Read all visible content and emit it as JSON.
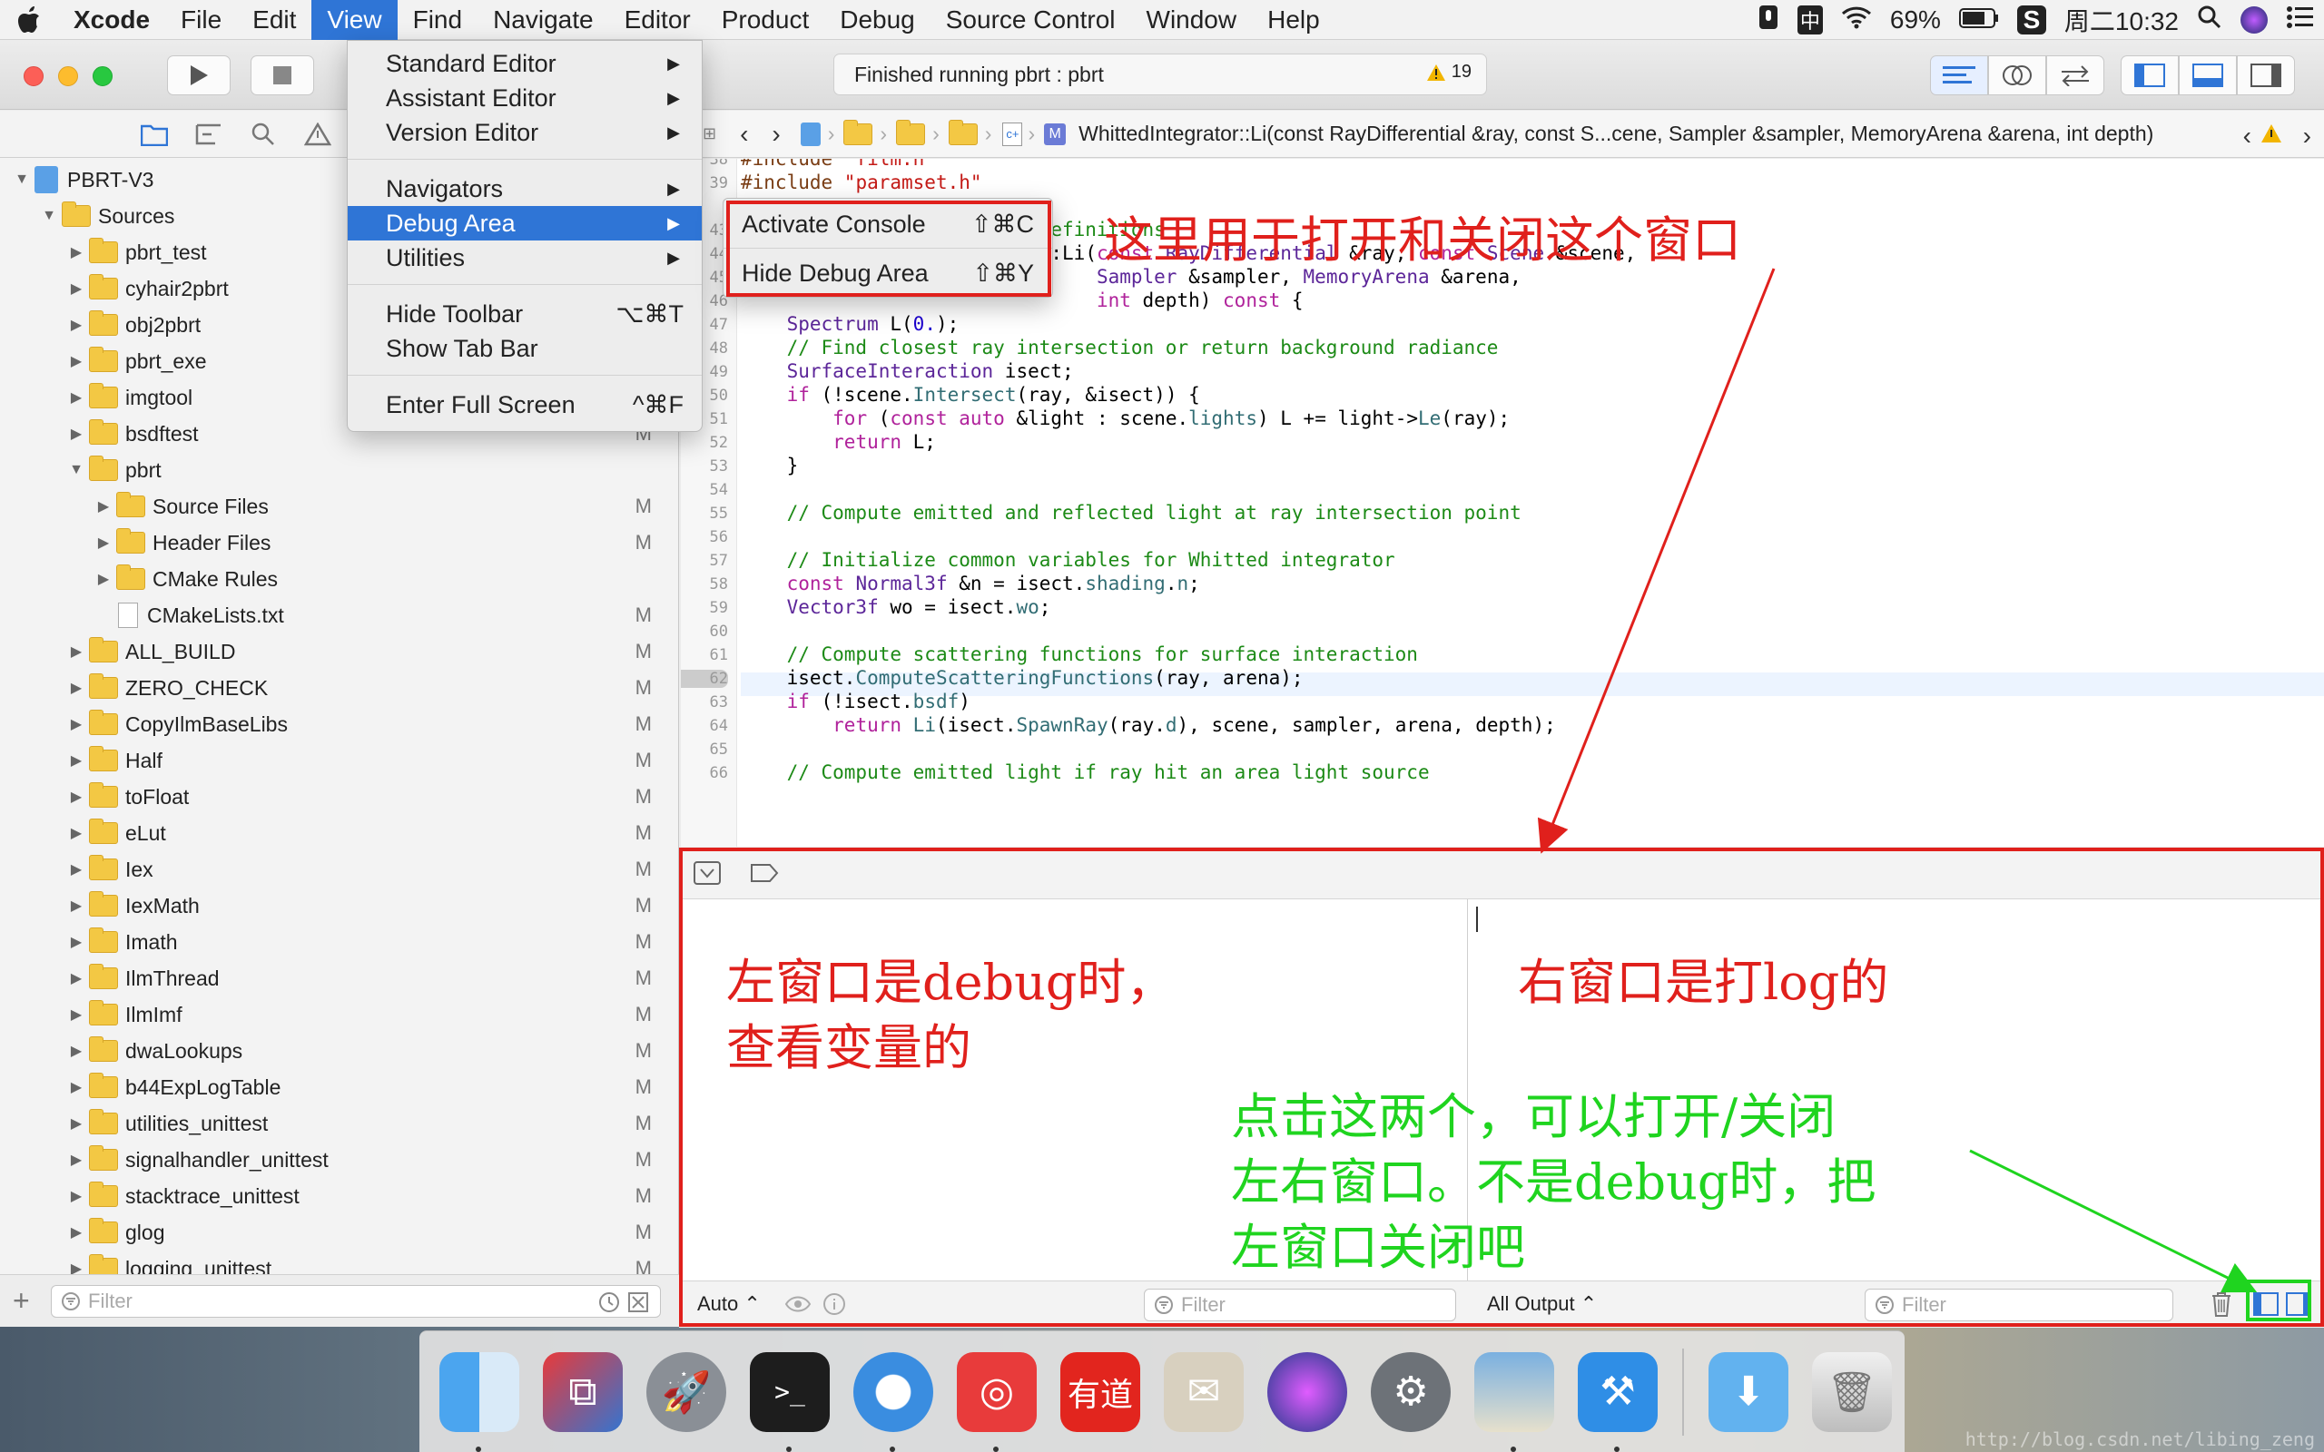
{
  "menubar": {
    "app": "Xcode",
    "items": [
      "File",
      "Edit",
      "View",
      "Find",
      "Navigate",
      "Editor",
      "Product",
      "Debug",
      "Source Control",
      "Window",
      "Help"
    ],
    "active": "View",
    "status": {
      "battery": "69%",
      "time": "周二10:32",
      "input1": "中"
    }
  },
  "toolbar": {
    "activity": "Finished running pbrt : pbrt",
    "warnings": "19"
  },
  "view_menu": {
    "items": [
      {
        "label": "Standard Editor",
        "submenu": true
      },
      {
        "label": "Assistant Editor",
        "submenu": true
      },
      {
        "label": "Version Editor",
        "submenu": true
      },
      {
        "label": "Navigators",
        "submenu": true
      },
      {
        "label": "Debug Area",
        "submenu": true
      },
      {
        "label": "Utilities",
        "submenu": true
      },
      {
        "label": "Hide Toolbar",
        "shortcut": "⌥⌘T"
      },
      {
        "label": "Show Tab Bar"
      },
      {
        "label": "Enter Full Screen",
        "shortcut": "^⌘F"
      }
    ],
    "submenu": [
      {
        "label": "Activate Console",
        "shortcut": "⇧⌘C"
      },
      {
        "label": "Hide Debug Area",
        "shortcut": "⇧⌘Y"
      }
    ]
  },
  "navigator": {
    "rows": [
      {
        "label": "PBRT-V3",
        "kind": "project",
        "level": 0,
        "open": true,
        "mark": ""
      },
      {
        "label": "Sources",
        "kind": "folder",
        "level": 1,
        "open": true,
        "mark": ""
      },
      {
        "label": "pbrt_test",
        "kind": "folder",
        "level": 2,
        "mark": "M"
      },
      {
        "label": "cyhair2pbrt",
        "kind": "folder",
        "level": 2,
        "mark": "M"
      },
      {
        "label": "obj2pbrt",
        "kind": "folder",
        "level": 2,
        "mark": "M"
      },
      {
        "label": "pbrt_exe",
        "kind": "folder",
        "level": 2,
        "mark": "M"
      },
      {
        "label": "imgtool",
        "kind": "folder",
        "level": 2,
        "mark": "M"
      },
      {
        "label": "bsdftest",
        "kind": "folder",
        "level": 2,
        "mark": "M"
      },
      {
        "label": "pbrt",
        "kind": "folder",
        "level": 2,
        "open": true,
        "mark": ""
      },
      {
        "label": "Source Files",
        "kind": "folder",
        "level": 3,
        "mark": "M"
      },
      {
        "label": "Header Files",
        "kind": "folder",
        "level": 3,
        "mark": "M"
      },
      {
        "label": "CMake Rules",
        "kind": "folder",
        "level": 3,
        "mark": ""
      },
      {
        "label": "CMakeLists.txt",
        "kind": "file",
        "level": 3,
        "mark": "M"
      },
      {
        "label": "ALL_BUILD",
        "kind": "folder",
        "level": 2,
        "mark": "M"
      },
      {
        "label": "ZERO_CHECK",
        "kind": "folder",
        "level": 2,
        "mark": "M"
      },
      {
        "label": "CopyIlmBaseLibs",
        "kind": "folder",
        "level": 2,
        "mark": "M"
      },
      {
        "label": "Half",
        "kind": "folder",
        "level": 2,
        "mark": "M"
      },
      {
        "label": "toFloat",
        "kind": "folder",
        "level": 2,
        "mark": "M"
      },
      {
        "label": "eLut",
        "kind": "folder",
        "level": 2,
        "mark": "M"
      },
      {
        "label": "Iex",
        "kind": "folder",
        "level": 2,
        "mark": "M"
      },
      {
        "label": "IexMath",
        "kind": "folder",
        "level": 2,
        "mark": "M"
      },
      {
        "label": "Imath",
        "kind": "folder",
        "level": 2,
        "mark": "M"
      },
      {
        "label": "IlmThread",
        "kind": "folder",
        "level": 2,
        "mark": "M"
      },
      {
        "label": "IlmImf",
        "kind": "folder",
        "level": 2,
        "mark": "M"
      },
      {
        "label": "dwaLookups",
        "kind": "folder",
        "level": 2,
        "mark": "M"
      },
      {
        "label": "b44ExpLogTable",
        "kind": "folder",
        "level": 2,
        "mark": "M"
      },
      {
        "label": "utilities_unittest",
        "kind": "folder",
        "level": 2,
        "mark": "M"
      },
      {
        "label": "signalhandler_unittest",
        "kind": "folder",
        "level": 2,
        "mark": "M"
      },
      {
        "label": "stacktrace_unittest",
        "kind": "folder",
        "level": 2,
        "mark": "M"
      },
      {
        "label": "glog",
        "kind": "folder",
        "level": 2,
        "mark": "M"
      },
      {
        "label": "logging_unittest",
        "kind": "folder",
        "level": 2,
        "mark": "M"
      }
    ],
    "filter_placeholder": "Filter"
  },
  "jumpbar": {
    "symbol": "WhittedIntegrator::Li(const RayDifferential &ray, const S...cene, Sampler &sampler, MemoryArena &arena, int depth)"
  },
  "code": {
    "lines": [
      {
        "n": "38",
        "html": "<span class='pp'>#include </span><span class='st'>\"film.h\"</span>"
      },
      {
        "n": "39",
        "html": "<span class='pp'>#include </span><span class='st'>\"paramset.h\"</span>"
      },
      {
        "n": "43",
        "html": "<span class='cm'>                        d Definitions</span>"
      },
      {
        "n": "44",
        "html": "<span class='ty'>Spectrum</span> <span class='ty'>WhittedIntegrator</span>::Li(<span class='kw'>const</span> <span class='ty'>RayDifferential</span> &amp;ray, <span class='kw'>const</span> <span class='ty'>Scene</span> &amp;scene,"
      },
      {
        "n": "45",
        "html": "                               <span class='ty'>Sampler</span> &amp;sampler, <span class='ty'>MemoryArena</span> &amp;arena,"
      },
      {
        "n": "46",
        "html": "                               <span class='kw'>int</span> depth) <span class='kw'>const</span> {"
      },
      {
        "n": "47",
        "html": "    <span class='ty'>Spectrum</span> L(<span class='nm'>0.</span>);"
      },
      {
        "n": "48",
        "html": "    <span class='cm'>// Find closest ray intersection or return background radiance</span>"
      },
      {
        "n": "49",
        "html": "    <span class='ty'>SurfaceInteraction</span> isect;"
      },
      {
        "n": "50",
        "html": "    <span class='kw'>if</span> (!scene.<span class='fn'>Intersect</span>(ray, &amp;isect)) {"
      },
      {
        "n": "51",
        "html": "        <span class='kw'>for</span> (<span class='kw'>const auto</span> &amp;light : scene.<span class='fn'>lights</span>) L += light-&gt;<span class='fn'>Le</span>(ray);"
      },
      {
        "n": "52",
        "html": "        <span class='kw'>return</span> L;"
      },
      {
        "n": "53",
        "html": "    }"
      },
      {
        "n": "54",
        "html": ""
      },
      {
        "n": "55",
        "html": "    <span class='cm'>// Compute emitted and reflected light at ray intersection point</span>"
      },
      {
        "n": "56",
        "html": ""
      },
      {
        "n": "57",
        "html": "    <span class='cm'>// Initialize common variables for Whitted integrator</span>"
      },
      {
        "n": "58",
        "html": "    <span class='kw'>const</span> <span class='ty'>Normal3f</span> &amp;n = isect.<span class='fn'>shading</span>.<span class='fn'>n</span>;"
      },
      {
        "n": "59",
        "html": "    <span class='ty'>Vector3f</span> wo = isect.<span class='fn'>wo</span>;"
      },
      {
        "n": "60",
        "html": ""
      },
      {
        "n": "61",
        "html": "    <span class='cm'>// Compute scattering functions for surface interaction</span>"
      },
      {
        "n": "62",
        "html": "    isect.<span class='fn'>ComputeScatteringFunctions</span>(ray, arena);"
      },
      {
        "n": "63",
        "html": "    <span class='kw'>if</span> (!isect.<span class='fn'>bsdf</span>)"
      },
      {
        "n": "64",
        "html": "        <span class='kw'>return</span> <span class='fn'>Li</span>(isect.<span class='fn'>SpawnRay</span>(ray.<span class='fn'>d</span>), scene, sampler, arena, depth);"
      },
      {
        "n": "65",
        "html": ""
      },
      {
        "n": "66",
        "html": "    <span class='cm'>// Compute emitted light if ray hit an area light source</span>"
      }
    ]
  },
  "debug": {
    "left_scope": "Auto ⌃",
    "right_scope": "All Output ⌃",
    "filter_placeholder": "Filter"
  },
  "annotations": {
    "top": "这里用于打开和关闭这个窗口",
    "left1": "左窗口是debug时，",
    "left2": "查看变量的",
    "right": "右窗口是打log的",
    "green1": "点击这两个，可以打开/关闭",
    "green2": "左右窗口。不是debug时，把",
    "green3": "左窗口关闭吧"
  },
  "watermark": "http://blog.csdn.net/libing_zeng",
  "colors": {
    "accent": "#2f75d6",
    "annotation_red": "#e0201c",
    "annotation_green": "#1fd41f"
  }
}
